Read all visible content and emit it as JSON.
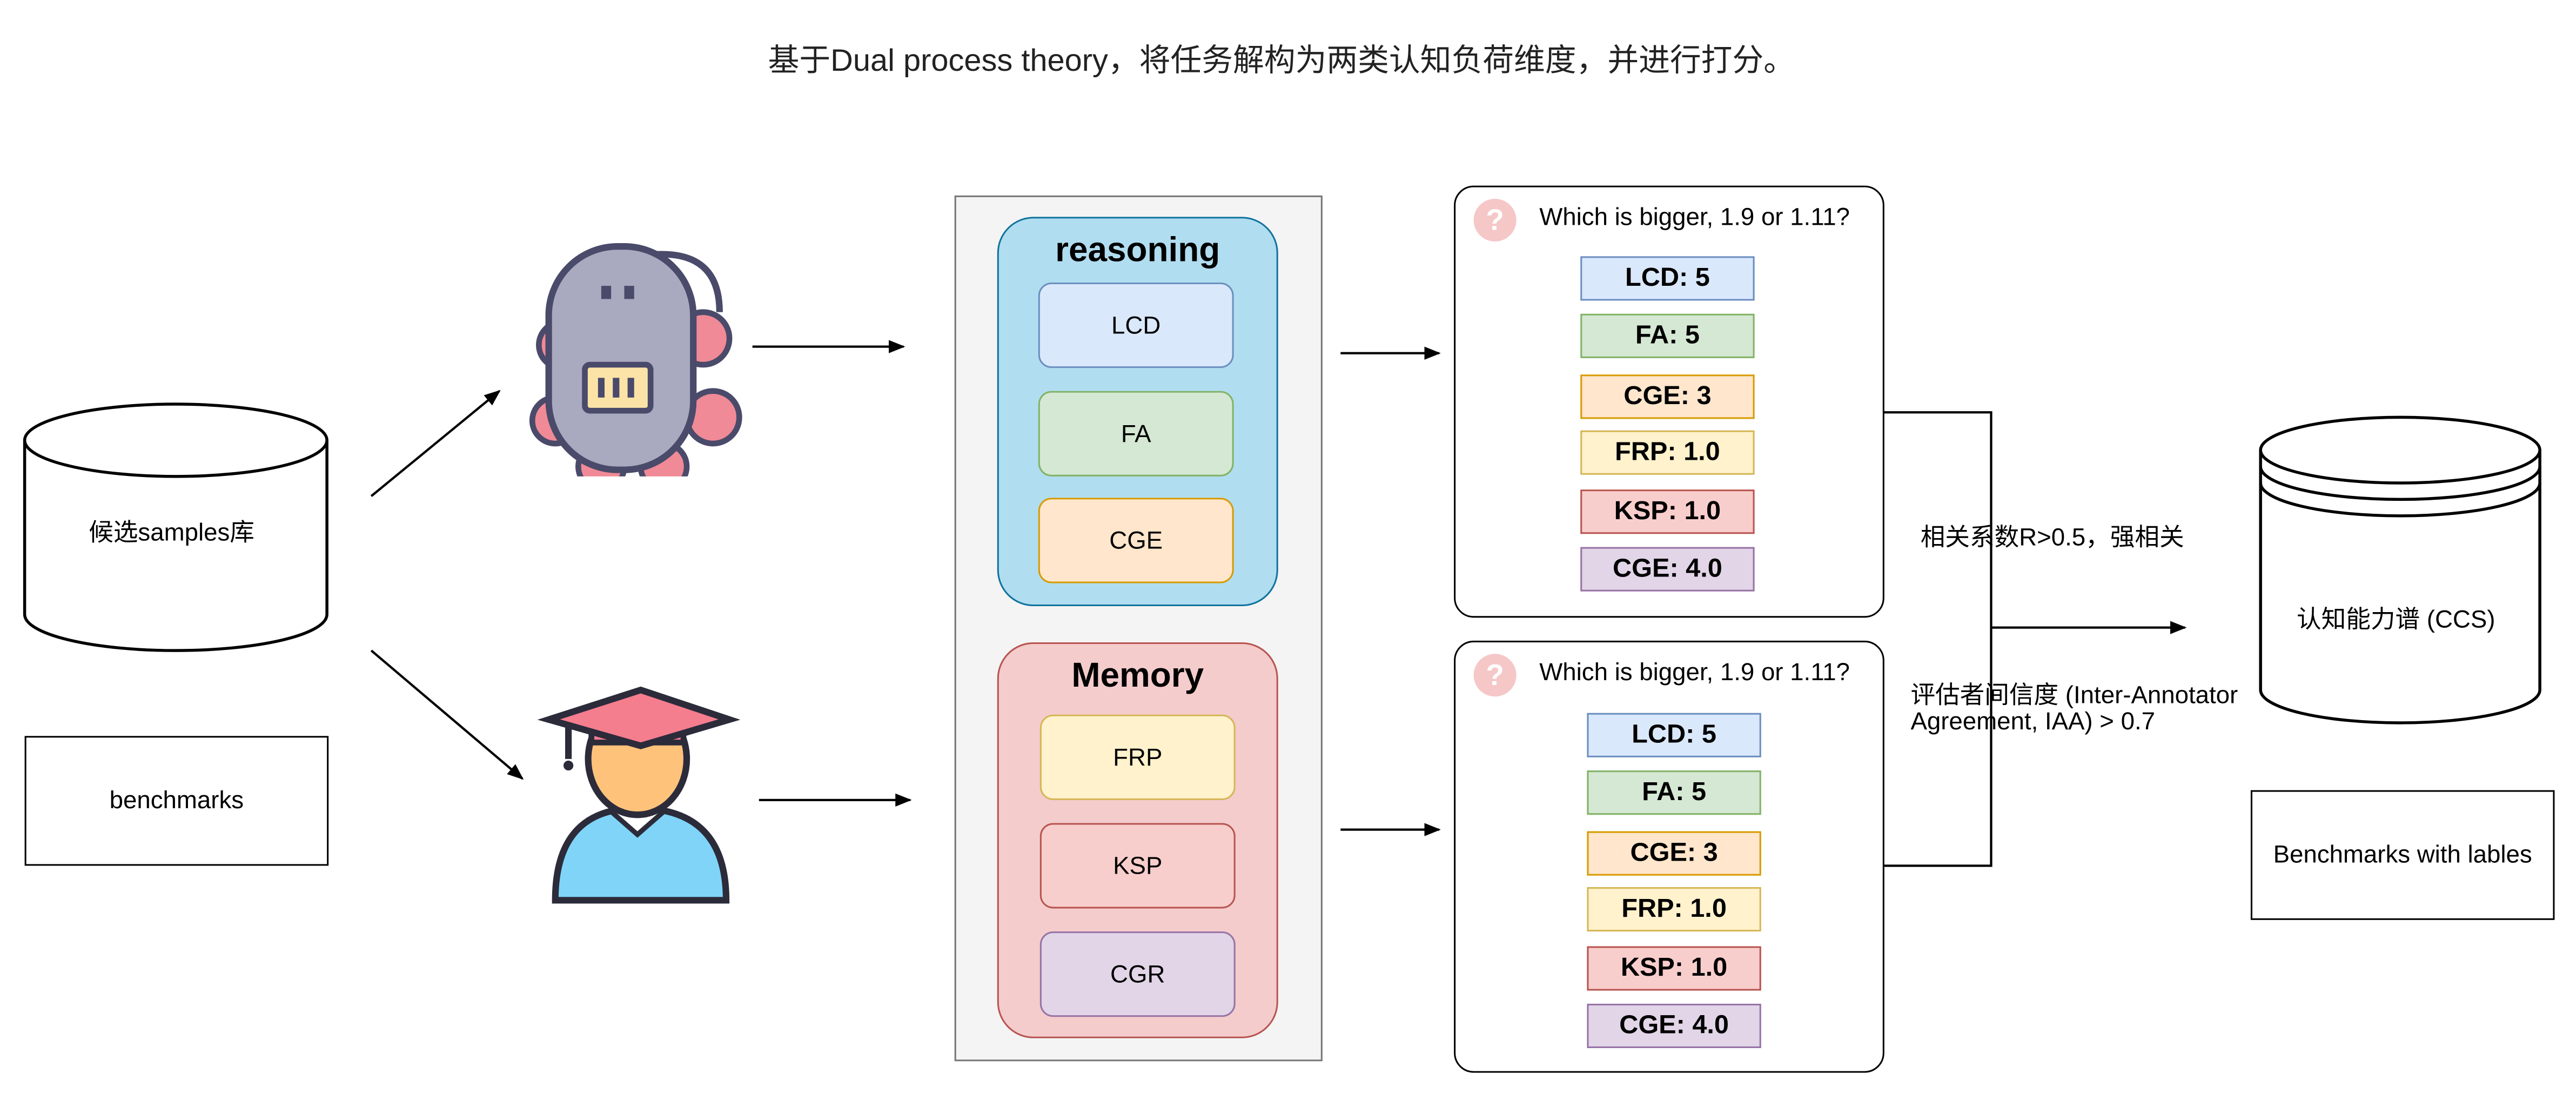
{
  "title": "基于Dual process theory，将任务解构为两类认知负荷维度，并进行打分。",
  "left": {
    "candidate_db": "候选samples库",
    "benchmarks": "benchmarks"
  },
  "groups": {
    "reasoning": {
      "title": "reasoning",
      "items": [
        "LCD",
        "FA",
        "CGE"
      ]
    },
    "memory": {
      "title": "Memory",
      "items": [
        "FRP",
        "KSP",
        "CGR"
      ]
    }
  },
  "cards": [
    {
      "question": "Which is bigger, 1.9 or 1.11?",
      "scores": [
        "LCD: 5",
        "FA: 5",
        "CGE: 3",
        "FRP: 1.0",
        "KSP: 1.0",
        "CGE: 4.0"
      ]
    },
    {
      "question": "Which is bigger, 1.9 or 1.11?",
      "scores": [
        "LCD: 5",
        "FA: 5",
        "CGE: 3",
        "FRP: 1.0",
        "KSP: 1.0",
        "CGE: 4.0"
      ]
    }
  ],
  "annotations": {
    "correlation": "相关系数R>0.5，强相关",
    "iaa_line1": "评估者间信度 (Inter-Annotator",
    "iaa_line2": "Agreement, IAA) > 0.7"
  },
  "right": {
    "ccs_db": "认知能力谱 (CCS)",
    "benchmarks_labels": "Benchmarks with lables"
  },
  "colors": {
    "blue_fill": "#dae8fc",
    "blue_stroke": "#6c8ebf",
    "green_fill": "#d5e8d4",
    "green_stroke": "#82b366",
    "orange_fill": "#ffe6cc",
    "orange_stroke": "#d79b00",
    "yellow_fill": "#fff2cc",
    "yellow_stroke": "#d6b656",
    "red_fill": "#f8cecc",
    "red_stroke": "#b85450",
    "purple_fill": "#e1d5e7",
    "purple_stroke": "#9673a6",
    "reasoning_bg": "#b1ddf0",
    "reasoning_stroke": "#10739e",
    "memory_bg": "#f4cccc",
    "memory_stroke": "#b85450"
  },
  "icons": [
    "robot-icon",
    "student-icon",
    "question-icon",
    "database-icon",
    "arrow-icon"
  ]
}
